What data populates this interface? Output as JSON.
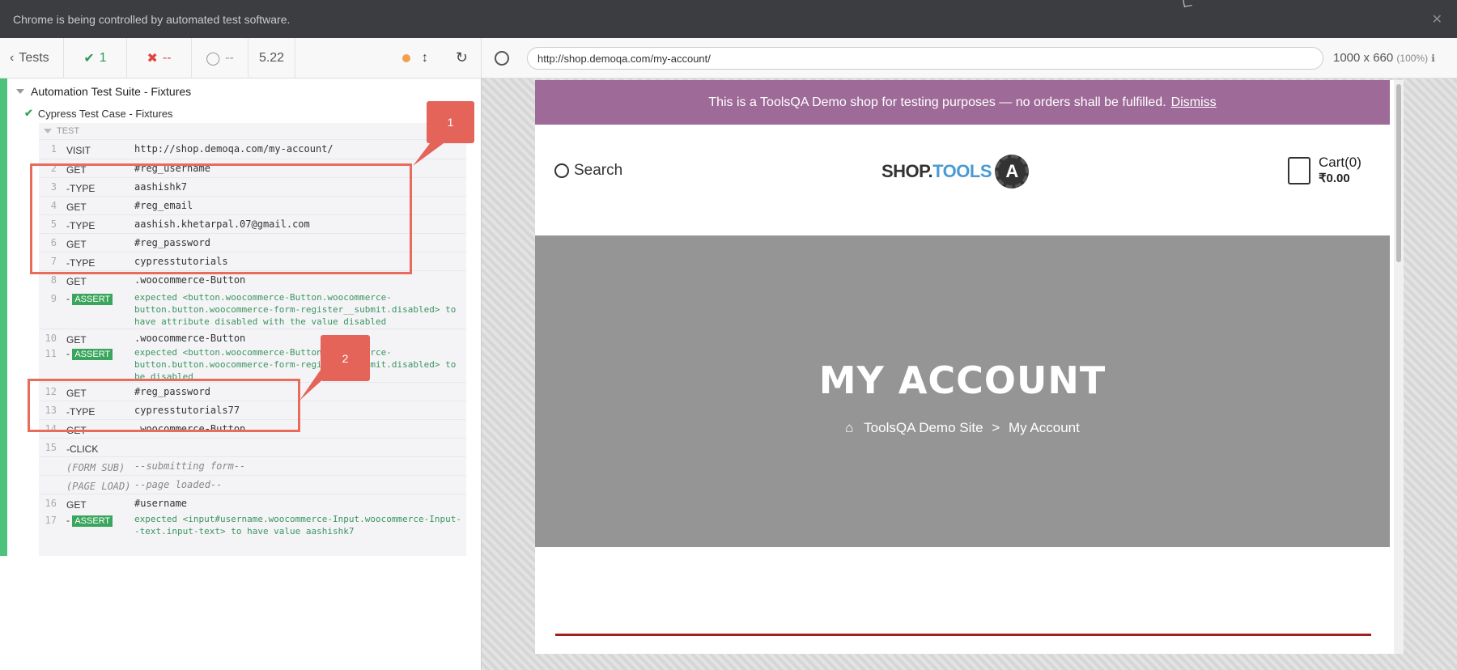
{
  "chrome": {
    "banner": "Chrome is being controlled by automated test software."
  },
  "reporter": {
    "tests_label": "Tests",
    "passed": "1",
    "failed": "--",
    "pending": "--",
    "duration": "5.22",
    "suite": "Automation Test Suite - Fixtures",
    "test_case": "Cypress Test Case - Fixtures",
    "test_label": "TEST",
    "commands": [
      {
        "num": "1",
        "name": "VISIT",
        "msg": "http://shop.demoqa.com/my-account/"
      },
      {
        "num": "2",
        "name": "GET",
        "msg": "#reg_username"
      },
      {
        "num": "3",
        "name": "-TYPE",
        "msg": "aashishk7"
      },
      {
        "num": "4",
        "name": "GET",
        "msg": "#reg_email"
      },
      {
        "num": "5",
        "name": "-TYPE",
        "msg": "aashish.khetarpal.07@gmail.com"
      },
      {
        "num": "6",
        "name": "GET",
        "msg": "#reg_password"
      },
      {
        "num": "7",
        "name": "-TYPE",
        "msg": "cypresstutorials"
      },
      {
        "num": "8",
        "name": "GET",
        "msg": ".woocommerce-Button"
      },
      {
        "num": "9",
        "name": "-ASSERT",
        "msg": "expected <button.woocommerce-Button.woocommerce-button.button.woocommerce-form-register__submit.disabled> to have attribute disabled with the value disabled"
      },
      {
        "num": "10",
        "name": "GET",
        "msg": ".woocommerce-Button"
      },
      {
        "num": "11",
        "name": "-ASSERT",
        "msg": "expected <button.woocommerce-Button.woocommerce-button.button.woocommerce-form-register__submit.disabled> to be disabled"
      },
      {
        "num": "12",
        "name": "GET",
        "msg": "#reg_password"
      },
      {
        "num": "13",
        "name": "-TYPE",
        "msg": "cypresstutorials77"
      },
      {
        "num": "14",
        "name": "GET",
        "msg": ".woocommerce-Button"
      },
      {
        "num": "15",
        "name": "-CLICK",
        "msg": ""
      },
      {
        "num": "",
        "name": "(FORM SUB)",
        "msg": "--submitting form--"
      },
      {
        "num": "",
        "name": "(PAGE LOAD)",
        "msg": "--page loaded--"
      },
      {
        "num": "16",
        "name": "GET",
        "msg": "#username"
      },
      {
        "num": "17",
        "name": "-ASSERT",
        "msg": "expected <input#username.woocommerce-Input.woocommerce-Input--text.input-text> to have value aashishk7"
      }
    ],
    "annotations": [
      "1",
      "2"
    ]
  },
  "aut": {
    "url": "http://shop.demoqa.com/my-account/",
    "viewport": "1000 x 660",
    "zoom": "(100%)",
    "demo_notice": "This is a ToolsQA Demo shop for testing purposes — no orders shall be fulfilled.",
    "dismiss": "Dismiss",
    "search": "Search",
    "logo_shop": "SHOP.",
    "logo_tools": "TOOLS",
    "logo_letter": "A",
    "cart_title": "Cart(0)",
    "cart_total": "₹0.00",
    "page_title": "MY ACCOUNT",
    "breadcrumb_home": "ToolsQA Demo Site",
    "breadcrumb_sep": ">",
    "breadcrumb_current": "My Account"
  },
  "colors": {
    "pass": "#3aa55c",
    "fail": "#e0463e",
    "annotation": "#e5645a",
    "demo_bar": "#9e6a98"
  }
}
